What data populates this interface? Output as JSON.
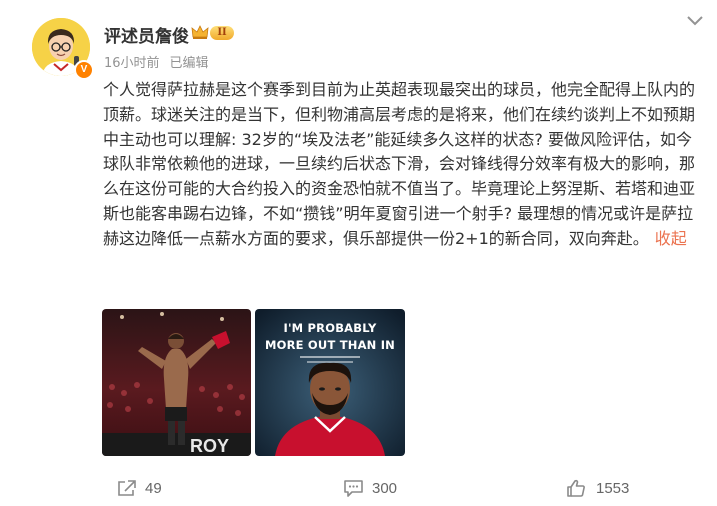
{
  "post": {
    "author": {
      "name": "评述员詹俊",
      "level_badge": "II",
      "verified_badge": "V"
    },
    "meta": {
      "time": "16小时前",
      "edited": "已编辑"
    },
    "text": "个人觉得萨拉赫是这个赛季到目前为止英超表现最突出的球员，他完全配得上队内的顶薪。球迷关注的是当下，但利物浦高层考虑的是将来，他们在续约谈判上不如预期中主动也可以理解: 32岁的“埃及法老”能延续多久这样的状态? 要做风险评估，如今球队非常依赖他的进球，一旦续约后状态下滑，会对锋线得分效率有极大的影响，那么在这份可能的大合约投入的资金恐怕就不值当了。毕竟理论上努涅斯、若塔和迪亚斯也能客串踢右边锋，不如“攒钱”明年夏窗引进一个射手? 最理想的情况或许是萨拉赫这边降低一点薪水方面的要求，俱乐部提供一份2+1的新合同，双向奔赴。",
    "collapse_label": "收起",
    "images": [
      {
        "name": "salah-celebration-photo"
      },
      {
        "name": "salah-poster",
        "caption_lines": [
          "I'M PROBABLY",
          "MORE OUT THAN IN"
        ]
      }
    ],
    "actions": {
      "share_count": "49",
      "comment_count": "300",
      "like_count": "1553"
    },
    "colors": {
      "link": "#eb7350",
      "meta": "#939393",
      "text": "#333333",
      "badge_orange": "#ff8200"
    },
    "icons": [
      "chevron-down-icon",
      "crown-icon",
      "share-icon",
      "comment-icon",
      "thumbs-up-icon"
    ]
  }
}
